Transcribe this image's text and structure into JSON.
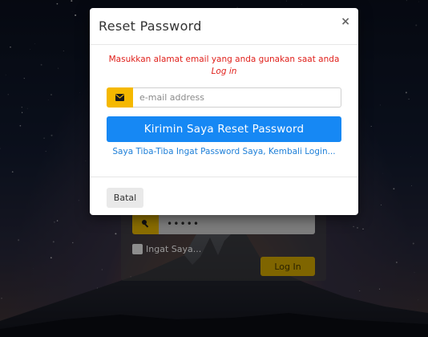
{
  "modal": {
    "title": "Reset Password",
    "close_label": "×",
    "notice_text": "Masukkan alamat email yang anda gunakan saat anda ",
    "notice_emphasis": "Log in",
    "email_placeholder": "e-mail address",
    "email_value": "",
    "email_icon": "envelope-icon",
    "reset_button_label": "Kirimin Saya Reset Password",
    "remember_link_text": "Saya Tiba-Tiba Ingat Password Saya, Kembali Login...",
    "cancel_button_label": "Batal"
  },
  "login": {
    "password_value": "•••••",
    "password_icon": "key-icon",
    "remember_label": "Ingat Saya...",
    "login_button_label": "Log In"
  },
  "colors": {
    "accent_yellow": "#f5b800",
    "primary_blue": "#1688f4",
    "notice_red": "#e0201b",
    "link_blue": "#1d7fd8"
  }
}
